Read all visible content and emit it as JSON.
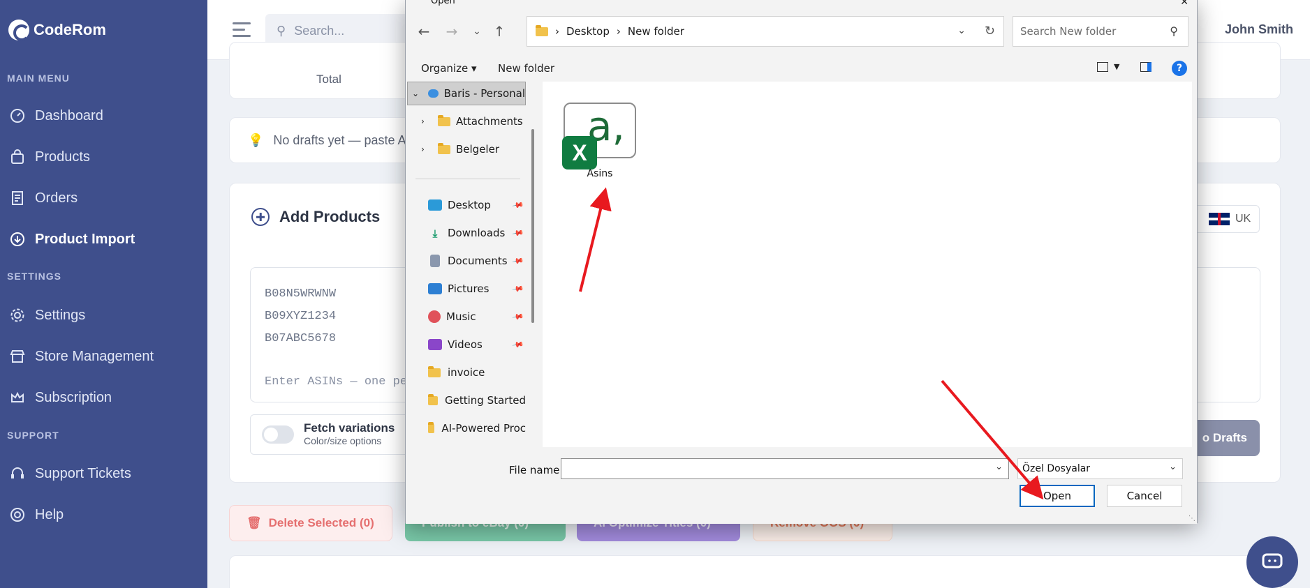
{
  "app": {
    "brand": "CodeRom",
    "user_name": "John Smith",
    "search_placeholder": "Search..."
  },
  "sidebar": {
    "sections": {
      "main": "MAIN MENU",
      "settings": "SETTINGS",
      "support": "SUPPORT"
    },
    "items": [
      {
        "label": "Dashboard",
        "icon": "gauge-icon"
      },
      {
        "label": "Products",
        "icon": "bag-icon"
      },
      {
        "label": "Orders",
        "icon": "receipt-icon"
      },
      {
        "label": "Product Import",
        "icon": "cloud-download-icon",
        "active": true
      },
      {
        "label": "Settings",
        "icon": "gear-icon"
      },
      {
        "label": "Store Management",
        "icon": "store-icon"
      },
      {
        "label": "Subscription",
        "icon": "crown-icon"
      },
      {
        "label": "Support Tickets",
        "icon": "headset-icon"
      },
      {
        "label": "Help",
        "icon": "lifebuoy-icon"
      }
    ]
  },
  "main": {
    "total_label": "Total",
    "drafts_notice": "No drafts yet — paste AS",
    "add_products_title": "Add Products",
    "region_badge": "UK",
    "asin_lines": [
      "B08N5WRWNW",
      "B09XYZ1234",
      "B07ABC5678"
    ],
    "asin_placeholder": "Enter ASINs — one pe",
    "fetch_variations_title": "Fetch variations",
    "fetch_variations_sub": "Color/size options",
    "drafts_button": "o Drafts",
    "actions": {
      "delete_selected": "Delete Selected (0)",
      "publish_ebay": "Publish to eBay (0)",
      "ai_optimize": "AI Optimize Titles (0)",
      "remove_oos": "Remove OOS (0)"
    }
  },
  "dialog": {
    "title": "Open",
    "breadcrumb": [
      "Desktop",
      "New folder"
    ],
    "search_placeholder": "Search New folder",
    "organize_label": "Organize",
    "new_folder_label": "New folder",
    "tree": [
      {
        "label": "Baris - Personal",
        "icon": "onedrive-icon",
        "selected": true
      },
      {
        "label": "Attachments",
        "icon": "folder-icon"
      },
      {
        "label": "Belgeler",
        "icon": "folder-icon"
      },
      {
        "label": "Desktop",
        "icon": "desktop-icon",
        "pinned": true
      },
      {
        "label": "Downloads",
        "icon": "download-icon",
        "pinned": true
      },
      {
        "label": "Documents",
        "icon": "documents-icon",
        "pinned": true
      },
      {
        "label": "Pictures",
        "icon": "pictures-icon",
        "pinned": true
      },
      {
        "label": "Music",
        "icon": "music-icon",
        "pinned": true
      },
      {
        "label": "Videos",
        "icon": "videos-icon",
        "pinned": true
      },
      {
        "label": "invoice",
        "icon": "folder-icon"
      },
      {
        "label": "Getting Started",
        "icon": "folder-icon"
      },
      {
        "label": "AI-Powered Proc",
        "icon": "folder-icon"
      }
    ],
    "files": [
      {
        "name": "Asins",
        "icon": "excel-file-icon"
      }
    ],
    "file_name_label": "File name:",
    "file_name_value": "",
    "file_type": "Özel Dosyalar",
    "open_button": "Open",
    "cancel_button": "Cancel"
  },
  "colors": {
    "sidebar_bg": "#3f4f8c",
    "annotation_arrow": "#e8191f",
    "excel_green": "#107c41",
    "open_button_border": "#0067c0"
  }
}
